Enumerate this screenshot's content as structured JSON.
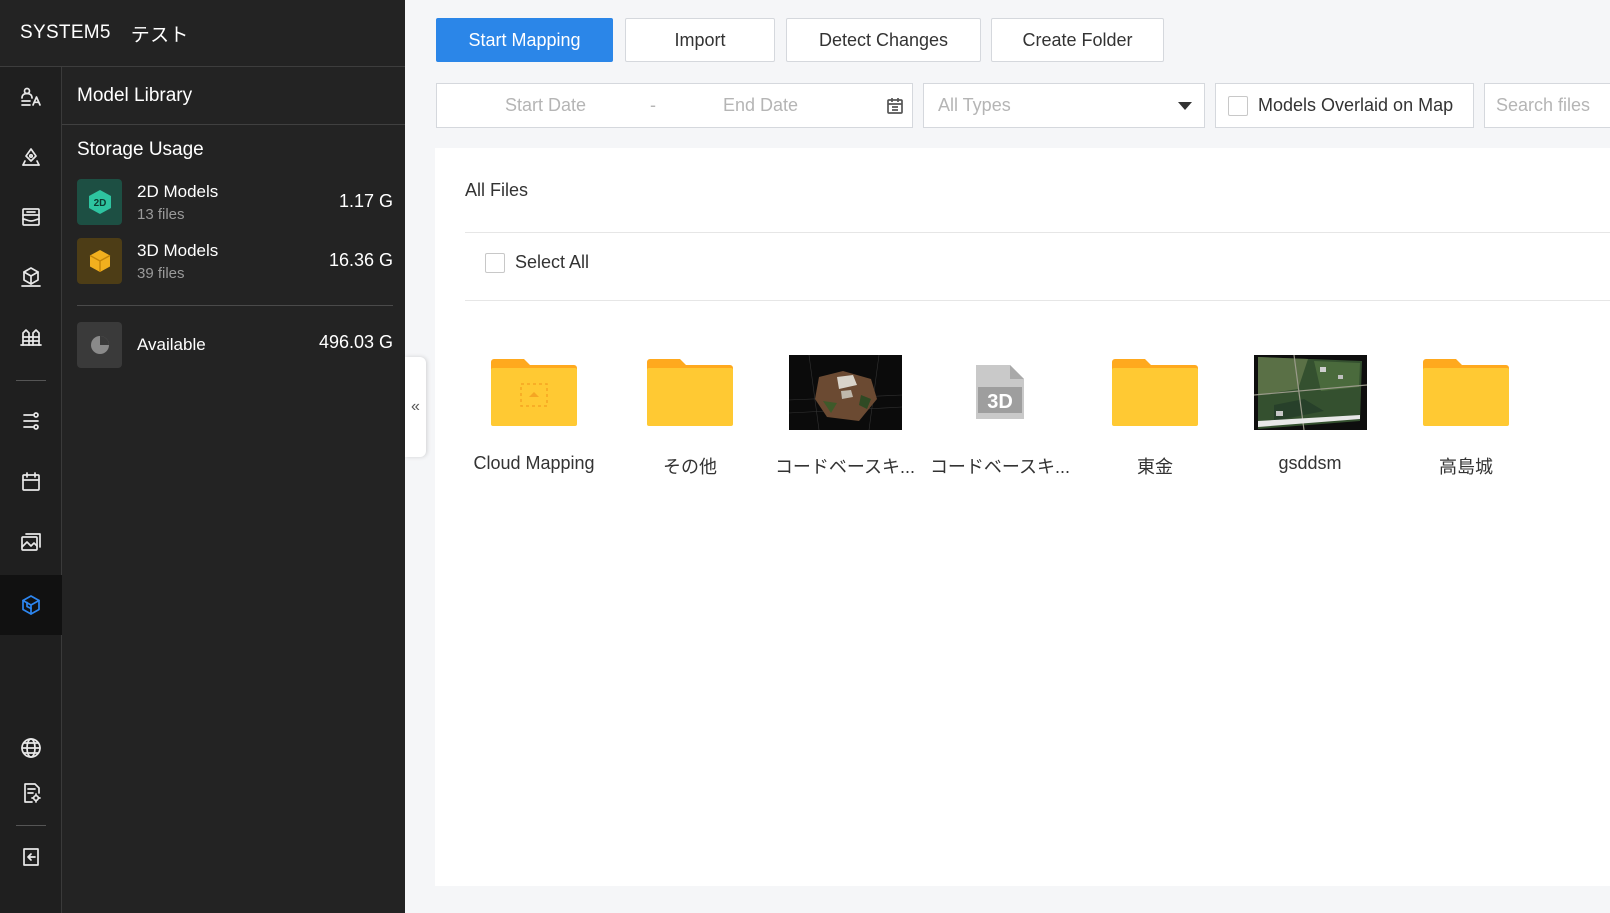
{
  "brand": {
    "name": "SYSTEM5",
    "workspace": "テスト"
  },
  "panel": {
    "title": "Model Library",
    "storage_title": "Storage Usage",
    "models": [
      {
        "name": "2D Models",
        "count": "13 files",
        "size": "1.17 G",
        "color": "#2ec4a0"
      },
      {
        "name": "3D Models",
        "count": "39 files",
        "size": "16.36 G",
        "color": "#f2b01e"
      }
    ],
    "available": {
      "label": "Available",
      "size": "496.03 G"
    }
  },
  "rail": {
    "items": [
      "team-icon",
      "waypoint-icon",
      "mission-icon",
      "device-icon",
      "site-icon",
      "flight-route-icon",
      "calendar-icon",
      "media-icon",
      "model-library-icon",
      "globe-icon",
      "settings-icon",
      "logout-icon"
    ],
    "active": "model-library-icon"
  },
  "toolbar": {
    "start_mapping": "Start Mapping",
    "import": "Import",
    "detect_changes": "Detect Changes",
    "create_folder": "Create Folder"
  },
  "filters": {
    "start_date": "Start Date",
    "separator": "-",
    "end_date": "End Date",
    "type": "All Types",
    "overlay": "Models Overlaid on Map",
    "search_placeholder": "Search files"
  },
  "content": {
    "breadcrumb": "All Files",
    "select_all": "Select All",
    "collapse_glyph": "«",
    "files": [
      {
        "name": "Cloud Mapping",
        "kind": "cloud-folder"
      },
      {
        "name": "その他",
        "kind": "folder"
      },
      {
        "name": "コードベースキ...",
        "kind": "model-3d-preview"
      },
      {
        "name": "コードベースキ...",
        "kind": "3d-file"
      },
      {
        "name": "東金",
        "kind": "folder"
      },
      {
        "name": "gsddsm",
        "kind": "map-2d-preview"
      },
      {
        "name": "高島城",
        "kind": "folder"
      }
    ]
  },
  "colors": {
    "accent": "#2b86e8",
    "folder": "#ffc933",
    "folder_tab": "#ffa91e"
  }
}
